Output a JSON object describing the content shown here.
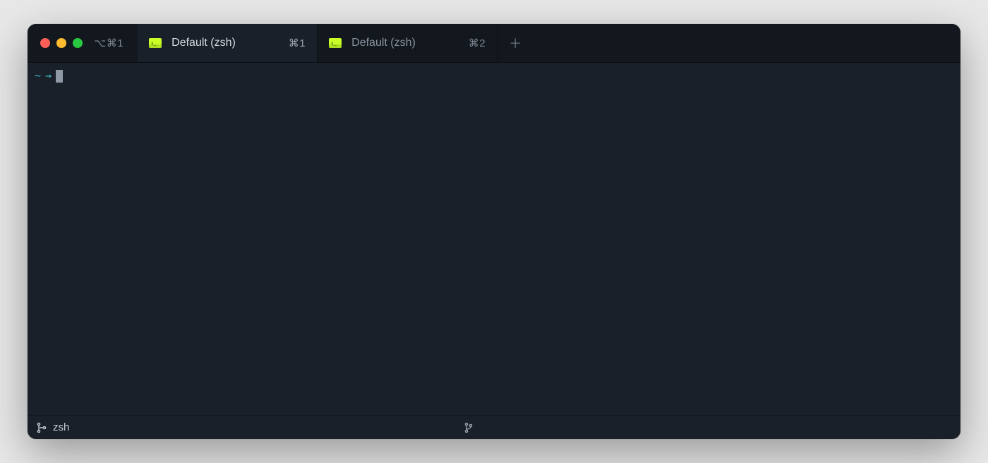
{
  "window": {
    "global_shortcut": "⌥⌘1"
  },
  "tabs": [
    {
      "label": "Default (zsh)",
      "hotkey": "⌘1",
      "active": true
    },
    {
      "label": "Default (zsh)",
      "hotkey": "⌘2",
      "active": false
    }
  ],
  "prompt": {
    "cwd": "~",
    "symbol": "→"
  },
  "status": {
    "shell": "zsh"
  },
  "colors": {
    "bg": "#1a2029",
    "tabbar": "#13181f",
    "accent_icon": "#caff27",
    "prompt_teal": "#3fbac2",
    "traffic_red": "#ff5f57",
    "traffic_yellow": "#febc2e",
    "traffic_green": "#28c840"
  }
}
